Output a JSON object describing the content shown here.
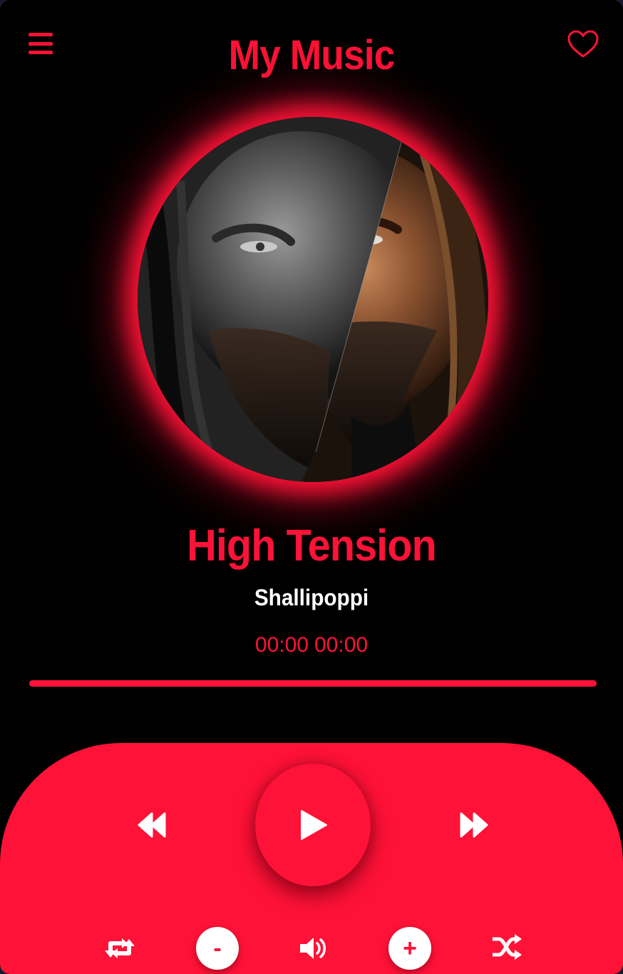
{
  "header": {
    "title": "My Music",
    "menu_icon": "hamburger-menu-icon",
    "favorite_icon": "heart-outline-icon"
  },
  "album_art": {
    "description": "circular album cover with red glow"
  },
  "track": {
    "title": "High Tension",
    "artist": "Shallipoppi",
    "current_time": "00:00",
    "duration": "00:00",
    "progress": 0
  },
  "controls": {
    "rewind_icon": "rewind-icon",
    "play_icon": "play-icon",
    "forward_icon": "fast-forward-icon",
    "repeat_icon": "repeat-icon",
    "volume_down_label": "-",
    "volume_icon": "volume-icon",
    "volume_up_label": "+",
    "shuffle_icon": "shuffle-icon"
  },
  "colors": {
    "accent": "#ff1237",
    "background": "#000000",
    "text_secondary": "#ffffff"
  }
}
